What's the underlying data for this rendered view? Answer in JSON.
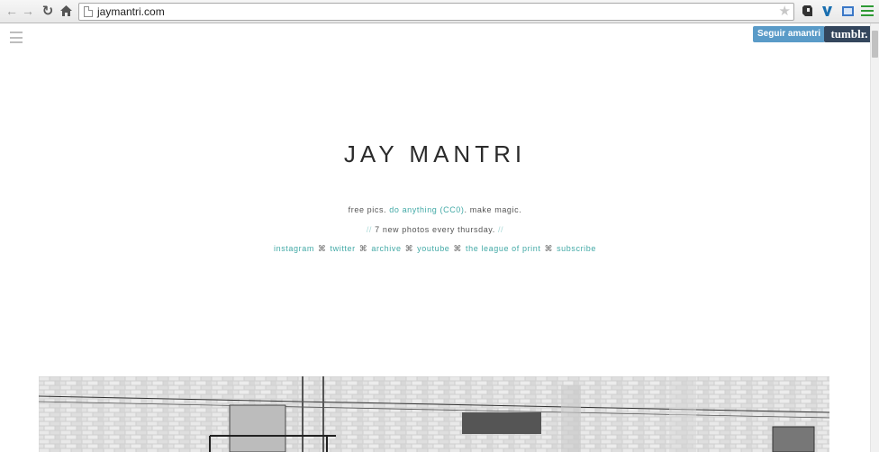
{
  "browser": {
    "url": "jaymantri.com"
  },
  "header": {
    "follow_label": "Seguir amantri",
    "tumblr_label": "tumblr."
  },
  "site": {
    "title": "JAY MANTRI",
    "tagline_prefix": "free pics.",
    "tagline_link": "do anything (CC0)",
    "tagline_suffix": ". make magic.",
    "slash_left": "//",
    "weekly": "7 new photos every thursday.",
    "slash_right": "//",
    "links": [
      "instagram",
      "twitter",
      "archive",
      "youtube",
      "the league of print",
      "subscribe"
    ],
    "separator": "⌘"
  },
  "icons": {
    "back": "arrow-left-icon",
    "forward": "arrow-right-icon",
    "reload": "reload-icon",
    "home": "home-icon",
    "page": "page-icon",
    "star": "star-icon",
    "menu": "hamburger-icon"
  },
  "colors": {
    "link": "#42a9a6",
    "follow_button": "#5a9bc8",
    "tumblr_button": "#34465d"
  }
}
